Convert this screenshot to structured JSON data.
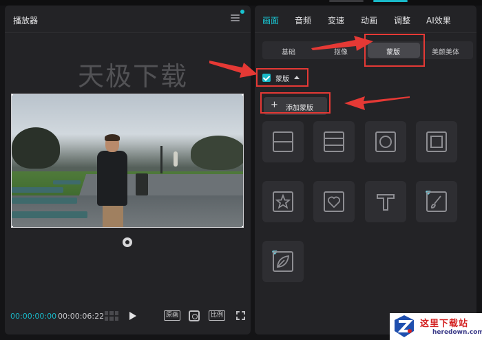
{
  "player": {
    "title": "播放器",
    "watermark": "天极下载",
    "time_current": "00:00:00:00",
    "time_total": "00:00:06:22",
    "original_label": "原画",
    "ratio_label": "比例"
  },
  "panel": {
    "tabs": [
      {
        "label": "画面",
        "active": true
      },
      {
        "label": "音频",
        "active": false
      },
      {
        "label": "变速",
        "active": false
      },
      {
        "label": "动画",
        "active": false
      },
      {
        "label": "调整",
        "active": false
      },
      {
        "label": "AI效果",
        "active": false
      }
    ],
    "subtabs": [
      {
        "label": "基础",
        "active": false
      },
      {
        "label": "抠像",
        "active": false
      },
      {
        "label": "蒙版",
        "active": true
      },
      {
        "label": "美颜美体",
        "active": false
      }
    ],
    "mask_section_label": "蒙版",
    "mask_checked": true,
    "add_mask_label": "添加蒙版",
    "mask_shapes": [
      {
        "name": "horizontal-split",
        "premium": false
      },
      {
        "name": "mirror",
        "premium": false
      },
      {
        "name": "circle",
        "premium": false
      },
      {
        "name": "rectangle",
        "premium": false
      },
      {
        "name": "star",
        "premium": false
      },
      {
        "name": "heart",
        "premium": false
      },
      {
        "name": "text",
        "premium": false
      },
      {
        "name": "brush",
        "premium": true
      },
      {
        "name": "leaf",
        "premium": true
      }
    ]
  },
  "colors": {
    "accent": "#19c3d0",
    "annotation": "#e53935",
    "panel_bg": "#232326"
  },
  "logo": {
    "title": "这里下载站",
    "subtitle": "heredown.com"
  }
}
